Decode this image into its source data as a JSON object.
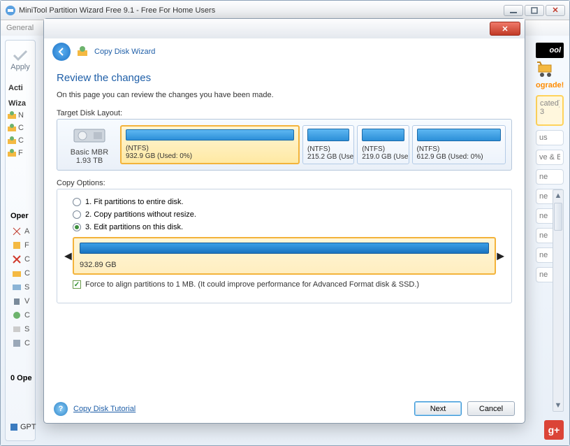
{
  "main": {
    "title": "MiniTool Partition Wizard Free 9.1 - Free For Home Users",
    "menu_general": "General",
    "apply": "Apply",
    "acti": "Acti",
    "wiza": "Wiza",
    "ops_hdr": "Oper",
    "op0": "0 Ope",
    "gpt": "GPT",
    "brand": "ool",
    "upgrade": "ograde!",
    "side1": "cated)",
    "side2": "us",
    "side3": "ve & Bi",
    "side4_items": [
      "ne",
      "ne",
      "ne",
      "ne",
      "ne",
      "ne"
    ]
  },
  "dialog": {
    "wiz_title": "Copy Disk Wizard",
    "review_title": "Review the changes",
    "review_sub": "On this page you can review the changes you have been made.",
    "layout_label": "Target Disk Layout:",
    "disk_type": "Basic MBR",
    "disk_size": "1.93 TB",
    "parts": [
      {
        "fs": "(NTFS)",
        "info": "932.9 GB (Used: 0%)",
        "selected": true,
        "flex": 4
      },
      {
        "fs": "(NTFS)",
        "info": "215.2 GB (Use",
        "selected": false,
        "flex": 1
      },
      {
        "fs": "(NTFS)",
        "info": "219.0 GB (Use",
        "selected": false,
        "flex": 1
      },
      {
        "fs": "(NTFS)",
        "info": "612.9 GB (Used: 0%)",
        "selected": false,
        "flex": 2
      }
    ],
    "copy_opts_label": "Copy Options:",
    "opts": [
      {
        "label": "1. Fit partitions to entire disk.",
        "checked": false
      },
      {
        "label": "2. Copy partitions without resize.",
        "checked": false
      },
      {
        "label": "3. Edit partitions on this disk.",
        "checked": true
      }
    ],
    "edit_size": "932.89 GB",
    "force_label": "Force to align partitions to 1 MB.  (It could improve performance for Advanced Format disk & SSD.)",
    "force_checked": true,
    "tutorial": "Copy Disk Tutorial",
    "next": "Next",
    "cancel": "Cancel"
  }
}
